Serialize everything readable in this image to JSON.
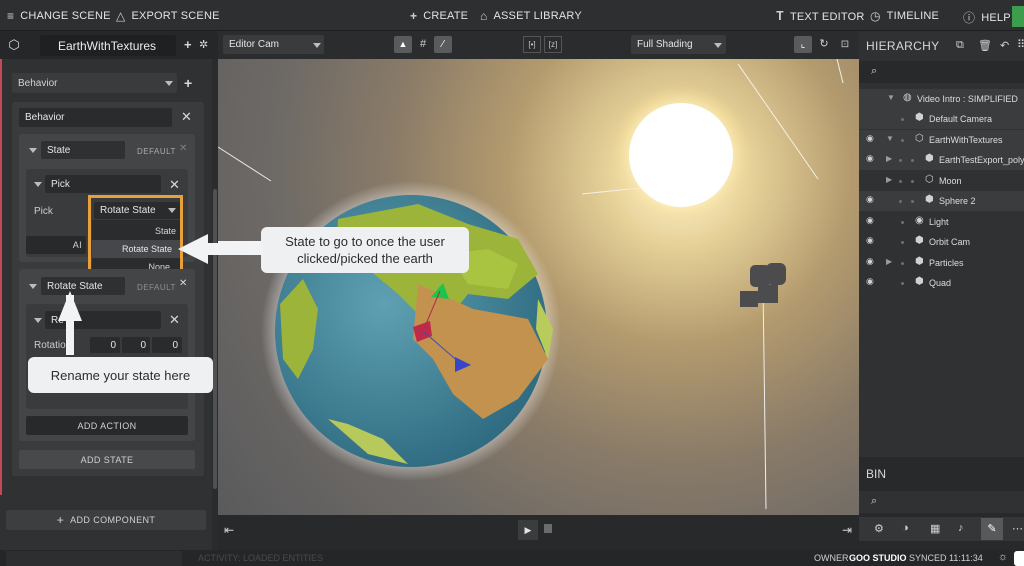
{
  "topbar": {
    "change_scene": "CHANGE SCENE",
    "export_scene": "EXPORT SCENE",
    "create": "CREATE",
    "asset_library": "ASSET LIBRARY",
    "text_editor": "TEXT EDITOR",
    "timeline": "TIMELINE",
    "help": "HELP"
  },
  "entity_name": "EarthWithTextures",
  "component_select": "Behavior",
  "behavior": {
    "name": "Behavior",
    "state1": {
      "name": "State",
      "default_label": "DEFAULT",
      "action": {
        "name": "Pick",
        "field_label": "Pick",
        "select_value": "Rotate State",
        "options": [
          "State",
          "Rotate State",
          "None"
        ],
        "hidden_button_partial": "AI"
      }
    },
    "state2": {
      "name": "Rotate State",
      "default_label": "DEFAULT",
      "action": {
        "name": "Re",
        "field_label": "Rotation",
        "values": [
          "0",
          "0",
          "0"
        ]
      },
      "add_action": "ADD ACTION"
    },
    "add_state": "ADD STATE"
  },
  "add_component": "ADD COMPONENT",
  "viewport": {
    "camera_select": "Editor Cam",
    "shading_select": "Full Shading"
  },
  "hierarchy": {
    "title": "HIERARCHY",
    "items": [
      {
        "label": "Video Intro : SIMPLIFIED",
        "icon": "globe-icon"
      },
      {
        "label": "Default Camera",
        "icon": "entity-icon"
      },
      {
        "label": "EarthWithTextures",
        "icon": "hexagon-icon"
      },
      {
        "label": "EarthTestExport_poly",
        "icon": "entity-icon"
      },
      {
        "label": "Moon",
        "icon": "hexagon-icon"
      },
      {
        "label": "Sphere 2",
        "icon": "entity-icon"
      },
      {
        "label": "Light",
        "icon": "light-icon"
      },
      {
        "label": "Orbit Cam",
        "icon": "entity-icon"
      },
      {
        "label": "Particles",
        "icon": "entity-icon"
      },
      {
        "label": "Quad",
        "icon": "entity-icon"
      }
    ]
  },
  "bin": {
    "title": "BIN"
  },
  "status": {
    "left": "ACTIVITY: LOADED ENTITIES",
    "owner_label": "OWNER",
    "owner": "GOO STUDIO",
    "synced": "SYNCED 11:11:34"
  },
  "callouts": {
    "pick": "State to go to once the user clicked/picked the earth",
    "rename": "Rename your state here"
  },
  "colors": {
    "accent_orange": "#e8a13a",
    "selection_bg": "#3b3c3e",
    "panel_bg": "#303133"
  }
}
